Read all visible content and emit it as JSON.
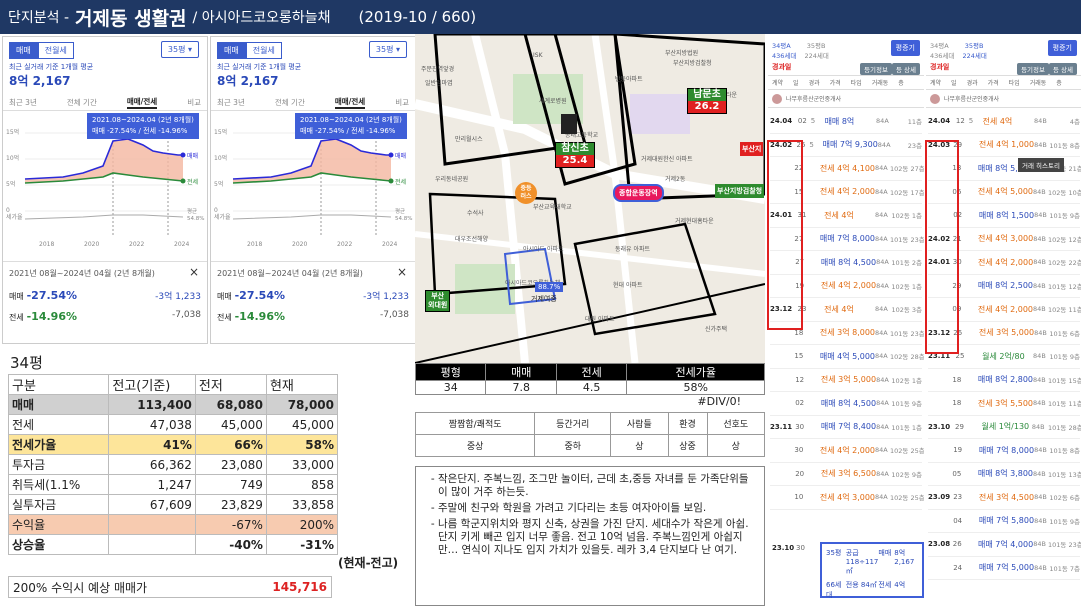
{
  "header": {
    "prefix": "단지분석 - ",
    "district": "거제동 생활권",
    "complex": "/ 아시아드코오롱하늘채",
    "meta": "(2019-10 / 660)"
  },
  "tradeA": {
    "tab_sale": "매매",
    "tab_jeonse": "전월세",
    "size_select": "35평",
    "subtitle": "최근 실거래 기준 1개월 평균",
    "price": "8억 2,167",
    "tabs": [
      "최근 3년",
      "전체 기간",
      "매매/전세",
      "비교"
    ],
    "tooltip_range": "2021.08~2024.04 (2년 8개월)",
    "tooltip_text": "매매 -27.54%  /  전세 -14.96%",
    "y_labels": [
      "15억",
      "10억",
      "5억",
      "0\n세가율"
    ],
    "x_labels": [
      "2018",
      "2020",
      "2022",
      "2024"
    ],
    "legend_sale": "매매",
    "legend_jeon": "전세",
    "legend_rate": "평균\n54.8%",
    "period": "2021년 08월~2024년 04월 (2년 8개월)",
    "close": "×",
    "sale_label": "매매",
    "sale_pct": "-27.54%",
    "sale_amt": "-3억 1,233",
    "jeon_label": "전세",
    "jeon_pct": "-14.96%",
    "jeon_amt": "-7,038"
  },
  "calc": {
    "title": "34평",
    "head": [
      "구분",
      "전고(기준)",
      "전저",
      "현재"
    ],
    "rows": [
      {
        "c": [
          "매매",
          "113,400",
          "68,080",
          "78,000"
        ],
        "cls": "gray",
        "bold": true
      },
      {
        "c": [
          "전세",
          "47,038",
          "45,000",
          "45,000"
        ],
        "cls": "",
        "bold": false
      },
      {
        "c": [
          "전세가율",
          "41%",
          "66%",
          "58%"
        ],
        "cls": "yel",
        "bold": true
      },
      {
        "c": [
          "투자금",
          "66,362",
          "23,080",
          "33,000"
        ],
        "cls": "",
        "bold": false
      },
      {
        "c": [
          "취득세(1.1%",
          "1,247",
          "749",
          "858"
        ],
        "cls": "",
        "bold": false
      },
      {
        "c": [
          "실투자금",
          "67,609",
          "23,829",
          "33,858"
        ],
        "cls": "",
        "bold": false
      },
      {
        "c": [
          "수익율",
          "",
          "-67%",
          "200%"
        ],
        "cls": "pink",
        "bold": false
      },
      {
        "c": [
          "상승율",
          "",
          "-40%",
          "-31%"
        ],
        "cls": "",
        "bold": true
      }
    ],
    "note": "(현재-전고)",
    "footer_label": "200% 수익시 예상 매매가",
    "footer_value": "145,716"
  },
  "map": {
    "pois": [
      "ISK",
      "일반임마엽",
      "주문진역앞경",
      "부산지방법원",
      "부산지방검찰청",
      "세계로병원",
      "반동아파트",
      "만리월시스",
      "동래고등학교",
      "우리동네공원",
      "부산교육대학교",
      "수석사",
      "거제대원한신 아파트",
      "거제2동",
      "아시아드코오롱하늘채",
      "대우조선해양",
      "법조타운",
      "동래유 아파트",
      "현대 아파트",
      "거제현대홈타운",
      "신가주택",
      "대원 아파트",
      "아시아드 아파트"
    ],
    "labels": {
      "namun": "남문초",
      "namun_sub": "26.2",
      "chamshin": "참신초",
      "chamshin_sub": "25.4",
      "gwan": "종합운동장역",
      "busan_court": "부산지방검찰청",
      "jongmok": "중등\n러스",
      "jeyeo": "거제여중",
      "pct": "88.7%",
      "busang": "부산\n외대원",
      "right_label": "부산지"
    }
  },
  "stats": {
    "head": [
      "평형",
      "매매",
      "전세",
      "전세가율"
    ],
    "row": [
      "34",
      "7.8",
      "4.5",
      "58%"
    ],
    "extra": "#DIV/0!"
  },
  "scores": {
    "head": [
      "짬짬함/쾌적도",
      "등간거리",
      "사람들",
      "환경",
      "선호도"
    ],
    "row": [
      "중상",
      "중하",
      "상",
      "상중",
      "상"
    ]
  },
  "notes": [
    "작은단지. 주복느낌, 조그만 놀이터, 근데 초,중등 자녀를 둔 가족단위들이 많이 거주 하는듯.",
    "주말에 친구와 학원을 가려고 기다리는 초등 여자아이들 보임.",
    "나름 학군지위치와 평지 신축, 상권을 가진 단지. 세대수가 작은게 아쉽. 단지 키게  빼곤 입지 너무 좋음. 전고 10억 넘음. 주복느낌인게 아쉽지만… 연식이 지나도 입지 가치가 있을듯. 레카 3,4 단지보다 난 여기."
  ],
  "listA": {
    "type": "34평A",
    "households": "436세대",
    "type2": "35평B",
    "households2": "224세대",
    "btn": "평증기",
    "section": "경과일",
    "btn2": "등기정보",
    "btn3": "등 상세",
    "cols": [
      "계약",
      "일",
      "경과",
      "가격",
      "타입",
      "거래동",
      "층"
    ],
    "agent": "나무후름산군인중개사",
    "rows": [
      {
        "d": "24.04",
        "dd": "02",
        "t": "5",
        "kind": "매매",
        "p": "매매 8억",
        "a": "84A",
        "f": "11층"
      },
      {
        "d": "24.02",
        "dd": "26",
        "t": "5",
        "kind": "매매",
        "p": "매매 7억 9,300",
        "a": "84A",
        "f": "23층"
      },
      {
        "d": "",
        "dd": "22",
        "t": "",
        "kind": "전세",
        "p": "전세 4억 4,100",
        "a": "84A",
        "f": "102동 27층"
      },
      {
        "d": "",
        "dd": "15",
        "t": "",
        "kind": "전세",
        "p": "전세 4억 2,000",
        "a": "84A",
        "f": "102동 17층"
      },
      {
        "d": "24.01",
        "dd": "31",
        "t": "",
        "kind": "전세",
        "p": "전세 4억",
        "a": "84A",
        "f": "102동 1층"
      },
      {
        "d": "",
        "dd": "27",
        "t": "",
        "kind": "매매",
        "p": "매매 7억 8,000",
        "a": "84A",
        "f": "101동 23층"
      },
      {
        "d": "",
        "dd": "27",
        "t": "",
        "kind": "매매",
        "p": "매매 8억 4,500",
        "a": "84A",
        "f": "101동 2층"
      },
      {
        "d": "",
        "dd": "19",
        "t": "",
        "kind": "전세",
        "p": "전세 4억 2,000",
        "a": "84A",
        "f": "102동 1층"
      },
      {
        "d": "23.12",
        "dd": "23",
        "t": "",
        "kind": "전세",
        "p": "전세 4억",
        "a": "84A",
        "f": "102동 3층"
      },
      {
        "d": "",
        "dd": "18",
        "t": "",
        "kind": "전세",
        "p": "전세 3억 8,000",
        "a": "84A",
        "f": "101동 23층"
      },
      {
        "d": "",
        "dd": "15",
        "t": "",
        "kind": "매매",
        "p": "매매 4억 5,000",
        "a": "84A",
        "f": "102동 28층"
      },
      {
        "d": "",
        "dd": "12",
        "t": "",
        "kind": "전세",
        "p": "전세 3억 5,000",
        "a": "84A",
        "f": "102동 1층"
      },
      {
        "d": "",
        "dd": "02",
        "t": "",
        "kind": "매매",
        "p": "매매 8억 4,500",
        "a": "84A",
        "f": "101동 9층"
      },
      {
        "d": "23.11",
        "dd": "30",
        "t": "",
        "kind": "매매",
        "p": "매매 7억 8,400",
        "a": "84A",
        "f": "101동 1층"
      },
      {
        "d": "",
        "dd": "30",
        "t": "",
        "kind": "전세",
        "p": "전세 4억 2,000",
        "a": "84A",
        "f": "102동 25층"
      },
      {
        "d": "",
        "dd": "20",
        "t": "",
        "kind": "전세",
        "p": "전세 3억 6,500",
        "a": "84A",
        "f": "102동 9층"
      },
      {
        "d": "",
        "dd": "10",
        "t": "",
        "kind": "전세",
        "p": "전세 4억 3,000",
        "a": "84A",
        "f": "102동 25층"
      }
    ],
    "card": [
      "23.10",
      "30",
      "35평",
      "공급 118÷117㎡",
      "매매",
      "8억 2,167",
      "66세대",
      "전용 84㎡",
      "전세",
      "4억"
    ]
  },
  "listB": {
    "section": "경과일",
    "btn": "평증기",
    "btn2": "등기정보",
    "btn3": "등 상세",
    "history_btn": "거래 히스토리",
    "agent": "나무후름산군인중개사",
    "rows": [
      {
        "d": "24.04",
        "dd": "12",
        "t": "5",
        "kind": "전세",
        "p": "전세 4억",
        "a": "84B",
        "f": "4층"
      },
      {
        "d": "24.03",
        "dd": "29",
        "t": "",
        "kind": "전세",
        "p": "전세 4억 1,000",
        "a": "84B",
        "f": "101동 8층"
      },
      {
        "d": "",
        "dd": "13",
        "t": "",
        "kind": "매매",
        "p": "매매 8억 5,000",
        "a": "84B",
        "f": "101동 21층"
      },
      {
        "d": "",
        "dd": "06",
        "t": "",
        "kind": "전세",
        "p": "전세 4억 5,000",
        "a": "84B",
        "f": "102동 10층"
      },
      {
        "d": "",
        "dd": "02",
        "t": "",
        "kind": "매매",
        "p": "매매 8억 1,500",
        "a": "84B",
        "f": "101동 9층"
      },
      {
        "d": "24.02",
        "dd": "21",
        "t": "",
        "kind": "전세",
        "p": "전세 4억 3,000",
        "a": "84B",
        "f": "102동 12층"
      },
      {
        "d": "24.01",
        "dd": "30",
        "t": "",
        "kind": "전세",
        "p": "전세 4억 2,000",
        "a": "84B",
        "f": "102동 22층"
      },
      {
        "d": "",
        "dd": "29",
        "t": "",
        "kind": "매매",
        "p": "매매 8억 2,500",
        "a": "84B",
        "f": "101동 12층"
      },
      {
        "d": "",
        "dd": "09",
        "t": "",
        "kind": "전세",
        "p": "전세 4억 2,000",
        "a": "84B",
        "f": "102동 11층"
      },
      {
        "d": "23.12",
        "dd": "26",
        "t": "",
        "kind": "전세",
        "p": "전세 3억 5,000",
        "a": "84B",
        "f": "101동 6층"
      },
      {
        "d": "23.11",
        "dd": "25",
        "t": "",
        "kind": "월세",
        "p": "월세 2억/80",
        "a": "84B",
        "f": "101동 9층"
      },
      {
        "d": "",
        "dd": "18",
        "t": "",
        "kind": "매매",
        "p": "매매 8억 2,800",
        "a": "84B",
        "f": "101동 15층"
      },
      {
        "d": "",
        "dd": "18",
        "t": "",
        "kind": "전세",
        "p": "전세 3억 5,500",
        "a": "84B",
        "f": "101동 11층"
      },
      {
        "d": "23.10",
        "dd": "29",
        "t": "",
        "kind": "월세",
        "p": "월세 1억/130",
        "a": "84B",
        "f": "101동 28층"
      },
      {
        "d": "",
        "dd": "19",
        "t": "",
        "kind": "매매",
        "p": "매매 7억 8,000",
        "a": "84B",
        "f": "101동 8층"
      },
      {
        "d": "",
        "dd": "05",
        "t": "",
        "kind": "매매",
        "p": "매매 8억 3,800",
        "a": "84B",
        "f": "101동 13층"
      },
      {
        "d": "23.09",
        "dd": "23",
        "t": "",
        "kind": "전세",
        "p": "전세 3억 4,500",
        "a": "84B",
        "f": "102동 6층"
      },
      {
        "d": "",
        "dd": "04",
        "t": "",
        "kind": "매매",
        "p": "매매 7억 5,800",
        "a": "84B",
        "f": "101동 9층"
      },
      {
        "d": "23.08",
        "dd": "26",
        "t": "",
        "kind": "매매",
        "p": "매매 7억 4,000",
        "a": "84B",
        "f": "101동 23층"
      },
      {
        "d": "",
        "dd": "24",
        "t": "",
        "kind": "매매",
        "p": "매매 7억 5,000",
        "a": "84B",
        "f": "101동 7층"
      }
    ]
  },
  "colors": {
    "header": "#1f3864",
    "accent": "#3f5fd8",
    "sale": "#2a49b8",
    "jeonse": "#e06a10",
    "rent": "#2a8a3a",
    "red": "#e02020"
  }
}
